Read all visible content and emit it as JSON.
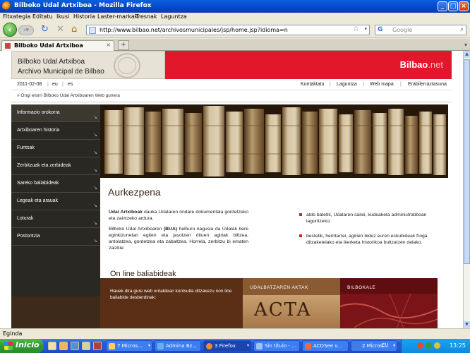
{
  "window": {
    "title": "Bilboko Udal Artxiboa - Mozilla Firefox"
  },
  "menu": [
    "Fitxategia",
    "Editatu",
    "Ikusi",
    "Historia",
    "Laster-markak",
    "Tresnak",
    "Laguntza"
  ],
  "nav": {
    "url": "http://www.bilbao.net/archivosmunicipales/jsp/home.jsp?idioma=n",
    "search_placeholder": "Google",
    "search_engine_letter": "G"
  },
  "tab": {
    "label": "Bilboko Udal Artxiboa",
    "new_tab": "+"
  },
  "header": {
    "title_eu": "Bilboko Udal Artxiboa",
    "title_es": "Archivo Municipal de Bilbao",
    "logo_main": "Bilbao",
    "logo_suffix": ".net",
    "brand_color": "#e3172c"
  },
  "utility": {
    "date": "2011-02-08",
    "lang_eu": "eu",
    "lang_es": "es",
    "links": [
      "Kontaktatu",
      "Laguntza",
      "Web mapa",
      "Erabilerraztasuna"
    ]
  },
  "welcome": "» Ongi etorri Bilboko Udal Artxiboaren Web gunera",
  "sidebar": {
    "items": [
      "Informazio orokorra",
      "Artxiboaren historia",
      "Funtsak",
      "Zerbitzuak eta zerbideak",
      "Sareko baliabideak",
      "Legeak eta arauak",
      "Loturak",
      "Postontzia"
    ],
    "arrow": "↘"
  },
  "main": {
    "heading": "Aurkezpena",
    "para1_bold": "Udal Artxiboak",
    "para1_rest": " dauka Udalaren ondare dokumentala gordetzeko eta zaintzeko ardura.",
    "para2_pre": "Bilboko Udal Artxiboaren ",
    "para2_bold": "(BUA)",
    "para2_rest": " helburu nagusia da Udalak bere eginkizunetan egiten eta jasotzen dituen agiriak biltzea, antolatzea, gordetzea eta zabaltzea. Horrela, zerbitzu bi ematen zaizkie:",
    "bullets": [
      "alde batetik, Udalaren sailei, kudeaketa administratiboan laguntzeko;",
      "bestetik, herritarrei, agirien bidez euren eskubideak froga ditzaketelako eta ikerketa historikoa bultzatzen delako."
    ],
    "online_title": "On line baliabideak",
    "panel_text": "Hauek dira gure web orrialdean kontsulta ditzakezu non line baliabide desberdinak:",
    "panel2_caption": "UDALBATZAREN AKTAK",
    "panel3_caption": "BILBOKALE",
    "acta_text": "ACTA"
  },
  "status": "Egindа",
  "taskbar": {
    "start": "Inicio",
    "tasks": [
      {
        "label": "7 Micros...",
        "has_arrow": true
      },
      {
        "label": "Admina Bz...",
        "has_arrow": false
      },
      {
        "label": "3 Firefox",
        "has_arrow": true,
        "active": true
      },
      {
        "label": "Sin título - ...",
        "has_arrow": false
      },
      {
        "label": "ACDSee v...",
        "has_arrow": false
      },
      {
        "label": "2 Micros...",
        "has_arrow": true
      }
    ],
    "lang": "EU",
    "clock": "13:25"
  }
}
